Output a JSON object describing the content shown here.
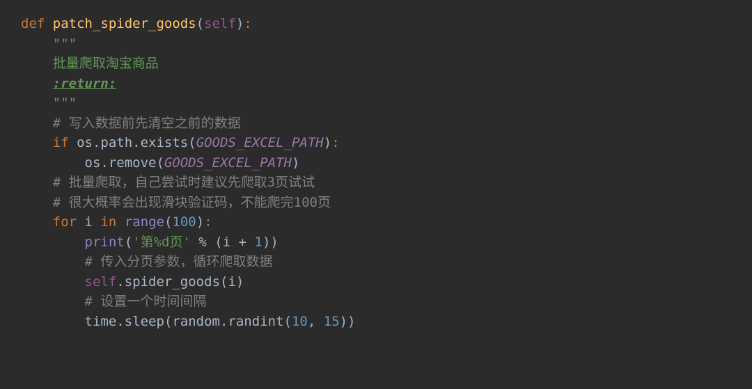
{
  "lines": {
    "l1": {
      "kw_def": "def ",
      "fn_name": "patch_spider_goods",
      "lparen": "(",
      "param": "self",
      "rparen": ")",
      "colon": ":"
    },
    "l2": "    \"\"\"",
    "l3": "    批量爬取淘宝商品",
    "l4_lead": "    ",
    "l4_text": ":return:",
    "l5": "    \"\"\"",
    "l6": "    # 写入数据前先清空之前的数据",
    "l7": {
      "indent": "    ",
      "kw_if": "if ",
      "os_path_exists": "os.path.exists",
      "lparen": "(",
      "const": "GOODS_EXCEL_PATH",
      "rparen": ")",
      "colon": ":"
    },
    "l8": {
      "indent": "        ",
      "os_remove": "os.remove",
      "lparen": "(",
      "const": "GOODS_EXCEL_PATH",
      "rparen": ")"
    },
    "l9": "    # 批量爬取，自己尝试时建议先爬取3页试试",
    "l10": "    # 很大概率会出现滑块验证码，不能爬完100页",
    "l11": {
      "indent": "    ",
      "kw_for": "for ",
      "var_i": "i",
      "sp1": " ",
      "kw_in": "in ",
      "range": "range",
      "lparen": "(",
      "num": "100",
      "rparen": ")",
      "colon": ":"
    },
    "l12": {
      "indent": "        ",
      "print": "print",
      "lparen": "(",
      "str": "'第%d页'",
      "pct": " % ",
      "lparen2": "(",
      "var_i": "i",
      "plus": " + ",
      "one": "1",
      "rparen2": ")",
      "rparen": ")"
    },
    "l13": "        # 传入分页参数，循环爬取数据",
    "l14": {
      "indent": "        ",
      "self": "self",
      "dot": ".",
      "method": "spider_goods",
      "lparen": "(",
      "var_i": "i",
      "rparen": ")"
    },
    "l15": "        # 设置一个时间间隔",
    "l16": {
      "indent": "        ",
      "time_sleep": "time.sleep",
      "lparen": "(",
      "random_randint": "random.randint",
      "lparen2": "(",
      "n1": "10",
      "comma": ", ",
      "n2": "15",
      "rparen2": ")",
      "rparen": ")"
    }
  }
}
